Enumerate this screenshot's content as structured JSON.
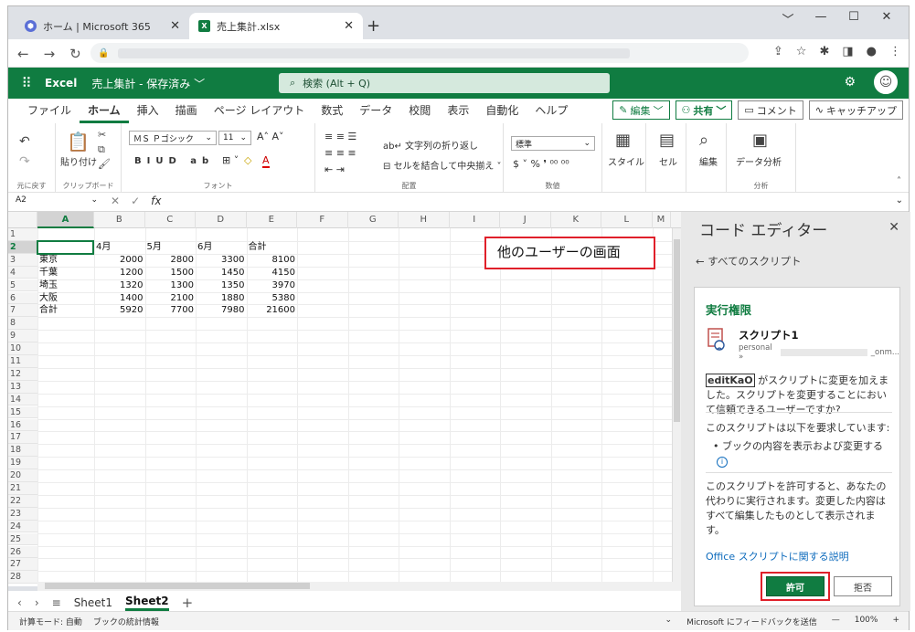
{
  "browser": {
    "tabs": [
      {
        "title": "ホーム | Microsoft 365",
        "active": false
      },
      {
        "title": "売上集計.xlsx",
        "active": true
      }
    ],
    "new_tab": "+",
    "window_controls": [
      "﹀",
      "—",
      "☐",
      "✕"
    ]
  },
  "excel": {
    "app_name": "Excel",
    "doc_name": "売上集計 - 保存済み ﹀",
    "search_placeholder": "検索 (Alt + Q)",
    "ribbon_tabs": [
      "ファイル",
      "ホーム",
      "挿入",
      "描画",
      "ページ レイアウト",
      "数式",
      "データ",
      "校閲",
      "表示",
      "自動化",
      "ヘルプ"
    ],
    "active_ribbon_tab": "ホーム",
    "ribbon_buttons": {
      "edit": "編集",
      "share": "共有",
      "comment": "コメント",
      "catchup": "キャッチアップ"
    },
    "ribbon": {
      "undo_label": "元に戻す",
      "clipboard_label": "クリップボード",
      "paste_label": "貼り付け",
      "font_name": "ＭＳ Ｐゴシック",
      "font_size": "11",
      "font_label": "フォント",
      "wrap_text": "文字列の折り返し",
      "merge_center": "セルを結合して中央揃え",
      "alignment_label": "配置",
      "number_format": "標準",
      "number_label": "数値",
      "style": "スタイル",
      "cells": "セル",
      "editing": "編集",
      "data_analysis": "データ分析",
      "analysis_label": "分析"
    },
    "name_box": "A2",
    "columns": [
      "A",
      "B",
      "C",
      "D",
      "E",
      "F",
      "G",
      "H",
      "I",
      "J",
      "K",
      "L",
      "M"
    ],
    "rows": [
      [
        "",
        "",
        "",
        "",
        ""
      ],
      [
        "",
        "4月",
        "5月",
        "6月",
        "合計"
      ],
      [
        "東京",
        "2000",
        "2800",
        "3300",
        "8100"
      ],
      [
        "千葉",
        "1200",
        "1500",
        "1450",
        "4150"
      ],
      [
        "埼玉",
        "1320",
        "1300",
        "1350",
        "3970"
      ],
      [
        "大阪",
        "1400",
        "2100",
        "1880",
        "5380"
      ],
      [
        "合計",
        "5920",
        "7700",
        "7980",
        "21600"
      ]
    ],
    "row_count": 28,
    "sheets": [
      "Sheet1",
      "Sheet2"
    ],
    "active_sheet": "Sheet2",
    "status": {
      "mode": "計算モード: 自動",
      "stats": "ブックの統計情報",
      "feedback": "Microsoft にフィードバックを送信",
      "zoom": "100%"
    }
  },
  "callout": "他のユーザーの画面",
  "code_editor": {
    "title": "コード エディター",
    "back_link": "すべてのスクリプト",
    "card_title": "実行権限",
    "script_name": "スクリプト1",
    "script_path_prefix": "personal »",
    "script_path_suffix": "_onm...",
    "user_name": "editKaO",
    "msg_after_user": "がスクリプトに変更を加えました。スクリプトを変更することにおいて信頼できるユーザーですか?",
    "requests_title": "このスクリプトは以下を要求しています:",
    "request_item": "ブックの内容を表示および変更する",
    "allow_desc": "このスクリプトを許可すると、あなたの代わりに実行されます。変更した内容はすべて編集したものとして表示されます。",
    "learn_link": "Office スクリプトに関する説明",
    "allow_button": "許可",
    "deny_button": "拒否"
  },
  "colors": {
    "excel_green": "#107c41",
    "highlight_red": "#e0202a"
  }
}
